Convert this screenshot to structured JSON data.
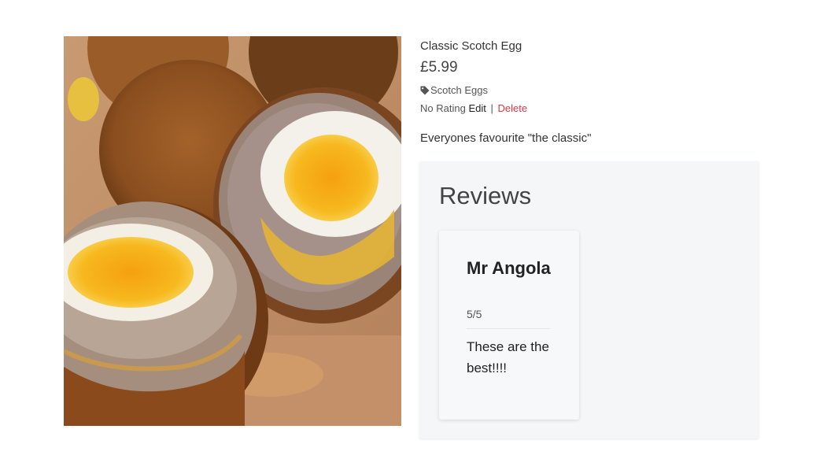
{
  "product": {
    "name": "Classic Scotch Egg",
    "price": "£5.99",
    "category": "Scotch Eggs",
    "rating_text": "No Rating",
    "edit_label": "Edit",
    "separator": "|",
    "delete_label": "Delete",
    "description": "Everyones favourite \"the classic\"",
    "image_icon": "scotch-egg-photo"
  },
  "reviews": {
    "title": "Reviews",
    "items": [
      {
        "author": "Mr Angola",
        "rating": "5/5",
        "text": "These are the best!!!!"
      }
    ]
  },
  "colors": {
    "delete": "#dc3545",
    "panel_bg": "#f5f6f8"
  }
}
